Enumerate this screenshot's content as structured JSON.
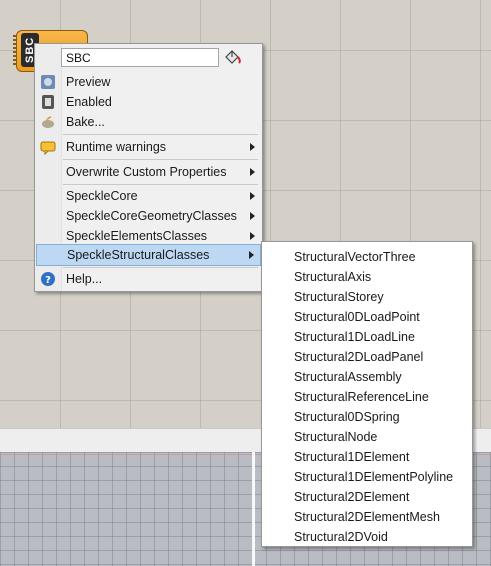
{
  "component": {
    "nickname": "SBC"
  },
  "menu": {
    "name_value": "SBC",
    "items": [
      {
        "label": "Preview",
        "icon": "preview-icon"
      },
      {
        "label": "Enabled",
        "icon": "enabled-icon"
      },
      {
        "label": "Bake...",
        "icon": "bake-icon"
      },
      {
        "label": "Runtime warnings",
        "icon": "warning-balloon-icon",
        "submenu": true
      },
      {
        "label": "Overwrite Custom Properties",
        "submenu": true
      },
      {
        "label": "SpeckleCore",
        "submenu": true
      },
      {
        "label": "SpeckleCoreGeometryClasses",
        "submenu": true
      },
      {
        "label": "SpeckleElementsClasses",
        "submenu": true
      },
      {
        "label": "SpeckleStructuralClasses",
        "submenu": true,
        "highlighted": true
      },
      {
        "label": "Help...",
        "icon": "help-icon"
      }
    ]
  },
  "submenu": {
    "items": [
      "StructuralVectorThree",
      "StructuralAxis",
      "StructuralStorey",
      "Structural0DLoadPoint",
      "Structural1DLoadLine",
      "Structural2DLoadPanel",
      "StructuralAssembly",
      "StructuralReferenceLine",
      "Structural0DSpring",
      "StructuralNode",
      "Structural1DElement",
      "Structural1DElementPolyline",
      "Structural2DElement",
      "Structural2DElementMesh",
      "Structural2DVoid"
    ]
  },
  "colors": {
    "highlight": "#bdd8f3",
    "component": "#f4a72e",
    "canvas": "#d4d0c8"
  }
}
